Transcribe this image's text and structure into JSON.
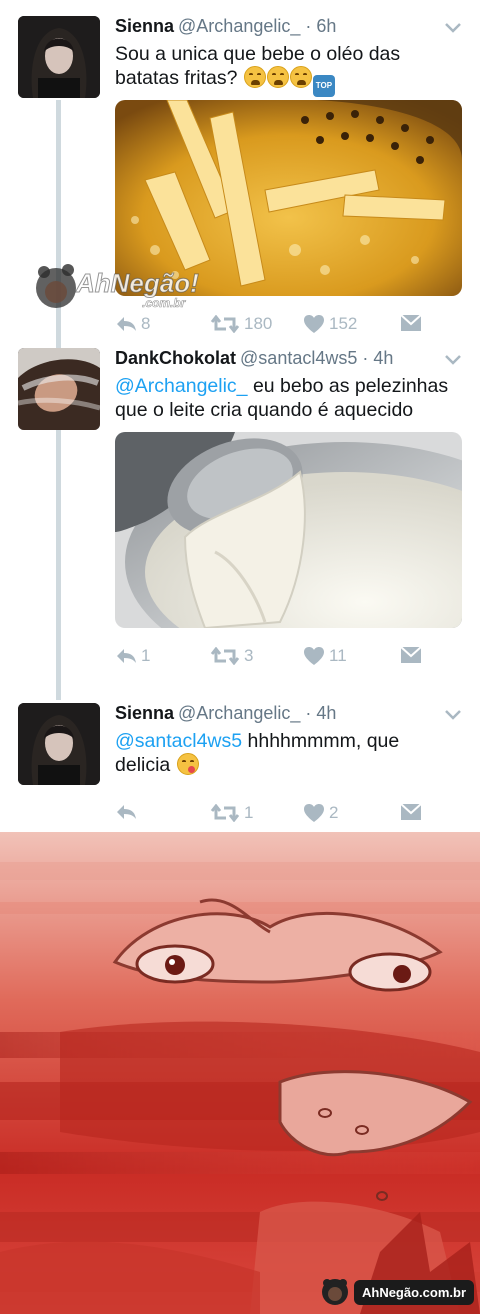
{
  "tweets": [
    {
      "name": "Sienna",
      "handle": "@Archangelic_",
      "time": "· 6h",
      "text": "Sou a unica que bebe o oléo das batatas fritas?",
      "emoji": [
        "weary-face-emoji",
        "weary-face-emoji",
        "weary-face-emoji",
        "top-arrow-emoji"
      ],
      "replies": "8",
      "retweets": "180",
      "likes": "152"
    },
    {
      "name": "DankChokolat",
      "handle": "@santacl4ws5",
      "time": "· 4h",
      "mention": "@Archangelic_",
      "text": " eu bebo as pelezinhas que o leite cria quando é aquecido",
      "replies": "1",
      "retweets": "3",
      "likes": "11"
    },
    {
      "name": "Sienna",
      "handle": "@Archangelic_",
      "time": "· 4h",
      "mention": "@santacl4ws5",
      "text": " hhhhmmmm, que delicia",
      "emoji": [
        "yum-face-emoji"
      ],
      "replies": "",
      "retweets": "1",
      "likes": "2"
    }
  ],
  "watermark": {
    "logo_text": "AhNegão!",
    "logo_sub": ".com.br",
    "footer_text": "AhNegão.com.br"
  },
  "colors": {
    "accent": "#1da1f2",
    "action_gray": "#aab8c2",
    "thread_line": "#cfd9de",
    "meme_red": "#d9473d"
  }
}
